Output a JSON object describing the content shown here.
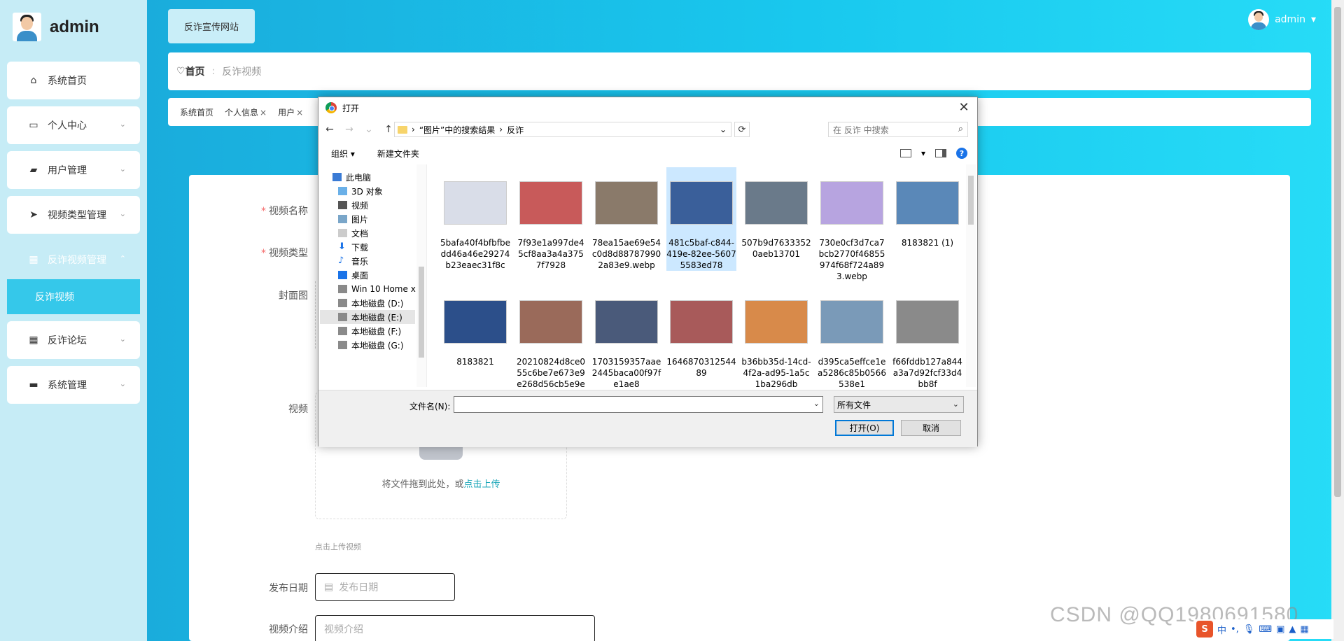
{
  "sidebar": {
    "logo_text": "admin",
    "items": [
      {
        "label": "系统首页",
        "icon": "home-icon"
      },
      {
        "label": "个人中心",
        "icon": "card-icon"
      },
      {
        "label": "用户管理",
        "icon": "briefcase-icon"
      },
      {
        "label": "视频类型管理",
        "icon": "send-icon"
      },
      {
        "label": "反诈视频管理",
        "icon": "grid-icon"
      },
      {
        "label": "反诈论坛",
        "icon": "grid-icon"
      },
      {
        "label": "系统管理",
        "icon": "ticket-icon"
      }
    ],
    "submenu_active": "反诈视频"
  },
  "header": {
    "tab": "反诈宣传网站",
    "user": "admin"
  },
  "breadcrumb": {
    "home": "首页",
    "current": "反诈视频"
  },
  "tags": [
    {
      "label": "系统首页",
      "closable": false
    },
    {
      "label": "个人信息",
      "closable": true
    },
    {
      "label": "用户",
      "closable": true
    }
  ],
  "form": {
    "video_name_label": "视频名称",
    "video_type_label": "视频类型",
    "cover_label": "封面图",
    "video_label": "视频",
    "upload_text": "将文件拖到此处，或",
    "upload_link": "点击上传",
    "upload_hint": "点击上传视频",
    "date_label": "发布日期",
    "date_placeholder": "发布日期",
    "intro_label": "视频介绍",
    "intro_placeholder": "视频介绍"
  },
  "dialog": {
    "title": "打开",
    "path": [
      "“图片”中的搜索结果",
      "反诈"
    ],
    "search_placeholder": "在 反诈 中搜索",
    "organize": "组织 ▾",
    "new_folder": "新建文件夹",
    "nav": [
      {
        "label": "此电脑",
        "icon": "computer-icon"
      },
      {
        "label": "3D 对象",
        "icon": "cube-icon"
      },
      {
        "label": "视频",
        "icon": "video-icon"
      },
      {
        "label": "图片",
        "icon": "picture-icon"
      },
      {
        "label": "文档",
        "icon": "document-icon"
      },
      {
        "label": "下载",
        "icon": "download-icon"
      },
      {
        "label": "音乐",
        "icon": "music-icon"
      },
      {
        "label": "桌面",
        "icon": "desktop-icon"
      },
      {
        "label": "Win 10 Home x",
        "icon": "drive-icon"
      },
      {
        "label": "本地磁盘 (D:)",
        "icon": "drive-icon"
      },
      {
        "label": "本地磁盘 (E:)",
        "icon": "drive-icon"
      },
      {
        "label": "本地磁盘 (F:)",
        "icon": "drive-icon"
      },
      {
        "label": "本地磁盘 (G:)",
        "icon": "drive-icon"
      }
    ],
    "files": [
      {
        "name": "5bafa40f4bfbfbedd46a46e29274b23eaec31f8c",
        "color": "#d9dde8"
      },
      {
        "name": "7f93e1a997de45cf8aa3a4a3757f7928",
        "color": "#c85a5a"
      },
      {
        "name": "78ea15ae69e54c0d8d887879902a83e9.webp",
        "color": "#8a7a6a"
      },
      {
        "name": "481c5baf-c844-419e-82ee-56075583ed78",
        "color": "#3a5f9a"
      },
      {
        "name": "507b9d76333520aeb13701",
        "color": "#6a7a8a"
      },
      {
        "name": "730e0cf3d7ca7bcb2770f46855974f68f724a893.webp",
        "color": "#b7a4e0"
      },
      {
        "name": "8183821 (1)",
        "color": "#5a88b8"
      },
      {
        "name": "8183821",
        "color": "#2c4f8a"
      },
      {
        "name": "20210824d8ce055c6be7e673e9e268d56cb5e9e",
        "color": "#9a6a5a"
      },
      {
        "name": "1703159357aae2445baca00f97fe1ae8",
        "color": "#4a5a7a"
      },
      {
        "name": "164687031254489",
        "color": "#a85a5a"
      },
      {
        "name": "b36bb35d-14cd-4f2a-ad95-1a5c1ba296db",
        "color": "#d88a4a"
      },
      {
        "name": "d395ca5effce1ea5286c85b0566538e1",
        "color": "#7a9ab8"
      },
      {
        "name": "f66fddb127a844a3a7d92fcf33d4bb8f",
        "color": "#8a8a8a"
      }
    ],
    "filename_label": "文件名(N):",
    "filetype": "所有文件",
    "open_button": "打开(O)",
    "cancel_button": "取消"
  },
  "watermark": "CSDN @QQ1980691580",
  "tray": {
    "ime": "中"
  }
}
